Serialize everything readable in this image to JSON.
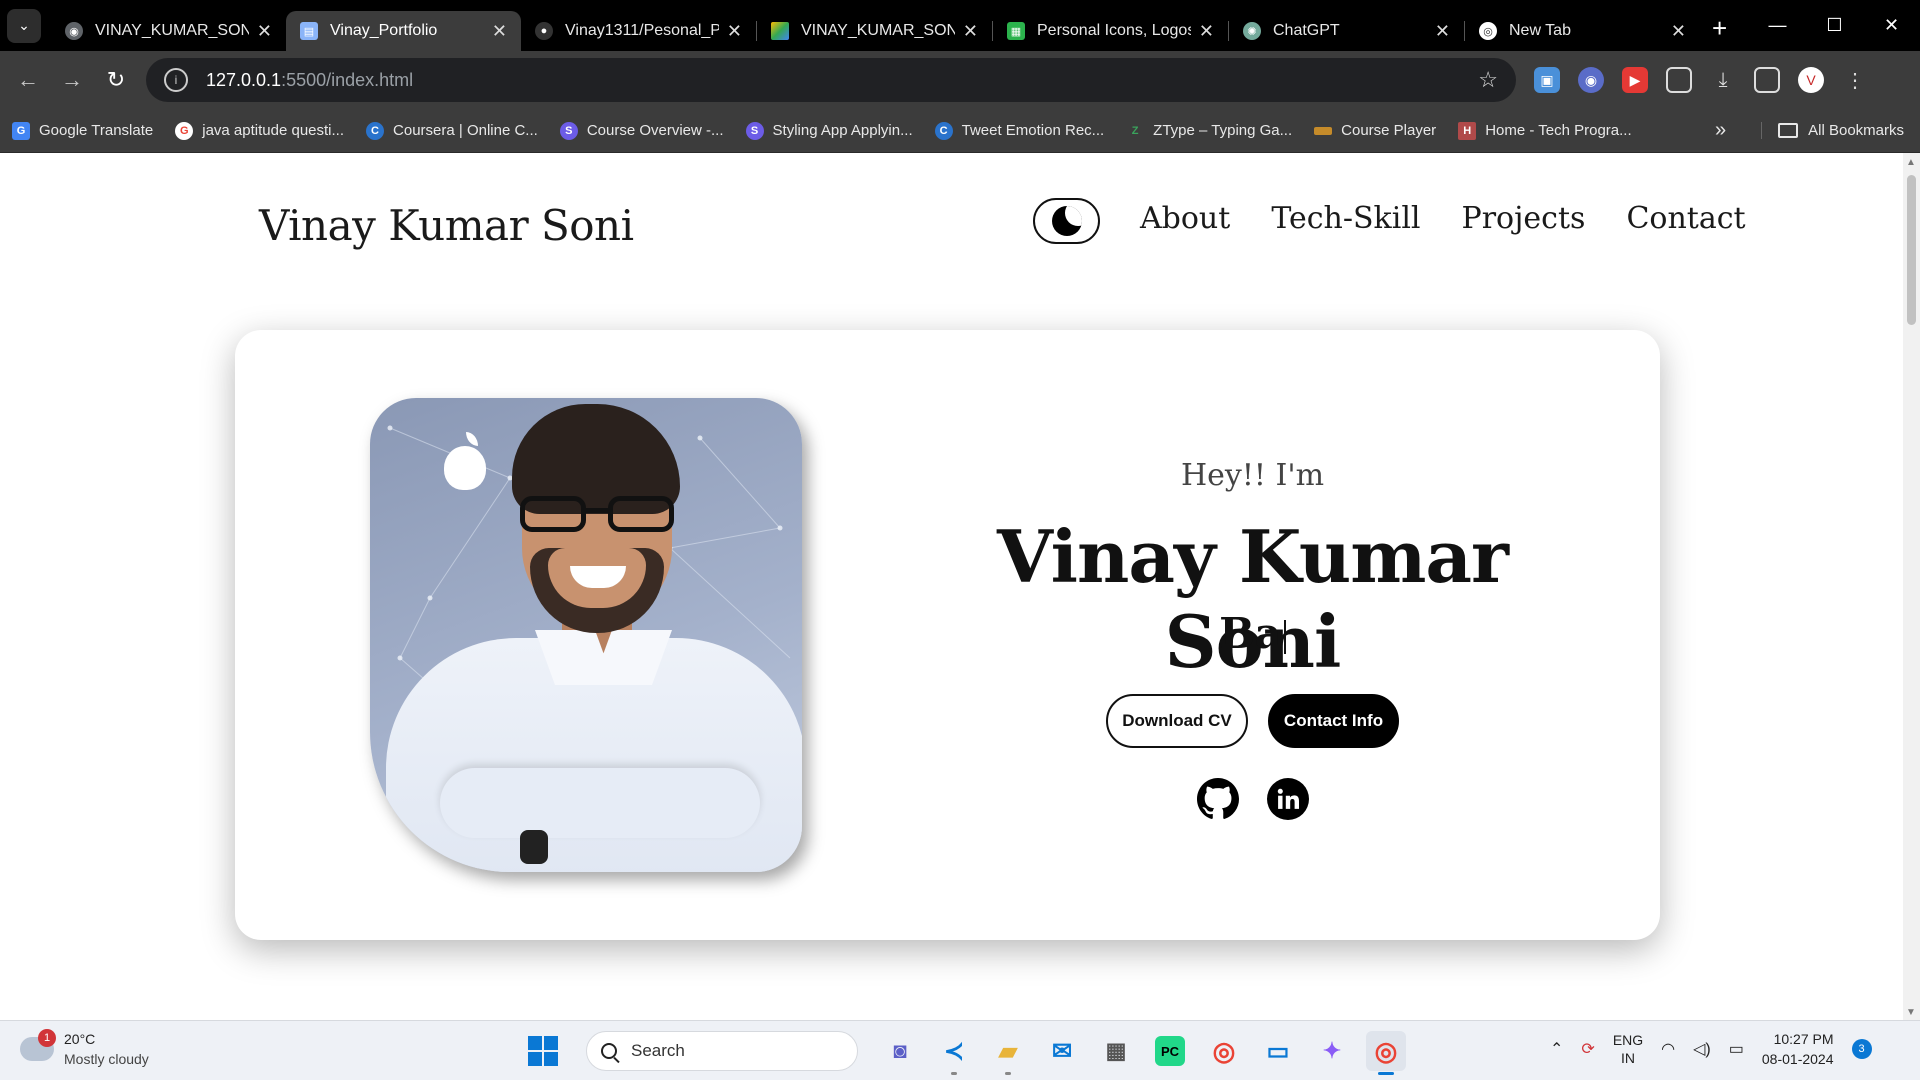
{
  "browser": {
    "tabs": [
      {
        "title": "VINAY_KUMAR_SON",
        "favicon": "globe-icon",
        "active": false
      },
      {
        "title": "Vinay_Portfolio",
        "favicon": "page-icon",
        "active": true
      },
      {
        "title": "Vinay1311/Pesonal_P",
        "favicon": "github-icon",
        "active": false
      },
      {
        "title": "VINAY_KUMAR_SON",
        "favicon": "drive-icon",
        "active": false
      },
      {
        "title": "Personal Icons, Logos",
        "favicon": "icons-site-icon",
        "active": false
      },
      {
        "title": "ChatGPT",
        "favicon": "chatgpt-icon",
        "active": false
      },
      {
        "title": "New Tab",
        "favicon": "chrome-icon",
        "active": false
      }
    ],
    "address": {
      "host": "127.0.0.1",
      "rest": ":5500/index.html"
    },
    "bookmarks": [
      {
        "label": "Google Translate",
        "icon": "translate-icon",
        "color": "#4285f4",
        "glyph": "G"
      },
      {
        "label": "java aptitude questi...",
        "icon": "google-icon",
        "color": "#ea4335",
        "glyph": "G"
      },
      {
        "label": "Coursera | Online C...",
        "icon": "coursera-icon",
        "color": "#2a73cc",
        "glyph": "C"
      },
      {
        "label": "Course Overview -...",
        "icon": "course-icon",
        "color": "#6c5ce7",
        "glyph": "S"
      },
      {
        "label": "Styling App Applyin...",
        "icon": "course-icon",
        "color": "#6c5ce7",
        "glyph": "S"
      },
      {
        "label": "Tweet Emotion Rec...",
        "icon": "coursera-icon",
        "color": "#2a73cc",
        "glyph": "C"
      },
      {
        "label": "ZType – Typing Ga...",
        "icon": "ztype-icon",
        "color": "#3aa35c",
        "glyph": "Z"
      },
      {
        "label": "Course Player",
        "icon": "player-icon",
        "color": "#c58b2a",
        "glyph": "▬"
      },
      {
        "label": "Home - Tech Progra...",
        "icon": "tech-icon",
        "color": "#b04a4a",
        "glyph": "H"
      }
    ],
    "all_bookmarks": "All Bookmarks"
  },
  "site": {
    "logo": "Vinay Kumar Soni",
    "nav": [
      "About",
      "Tech-Skill",
      "Projects",
      "Contact"
    ],
    "hero": {
      "greeting": "Hey!! I'm",
      "name": "Vinay Kumar Soni",
      "typed": "Ba",
      "download_cv": "Download CV",
      "contact_info": "Contact Info"
    }
  },
  "taskbar": {
    "weather": {
      "temp": "20°C",
      "condition": "Mostly cloudy",
      "badge": "1"
    },
    "search_placeholder": "Search",
    "lang": {
      "line1": "ENG",
      "line2": "IN"
    },
    "time": "10:27 PM",
    "date": "08-01-2024",
    "notifications": "3"
  }
}
